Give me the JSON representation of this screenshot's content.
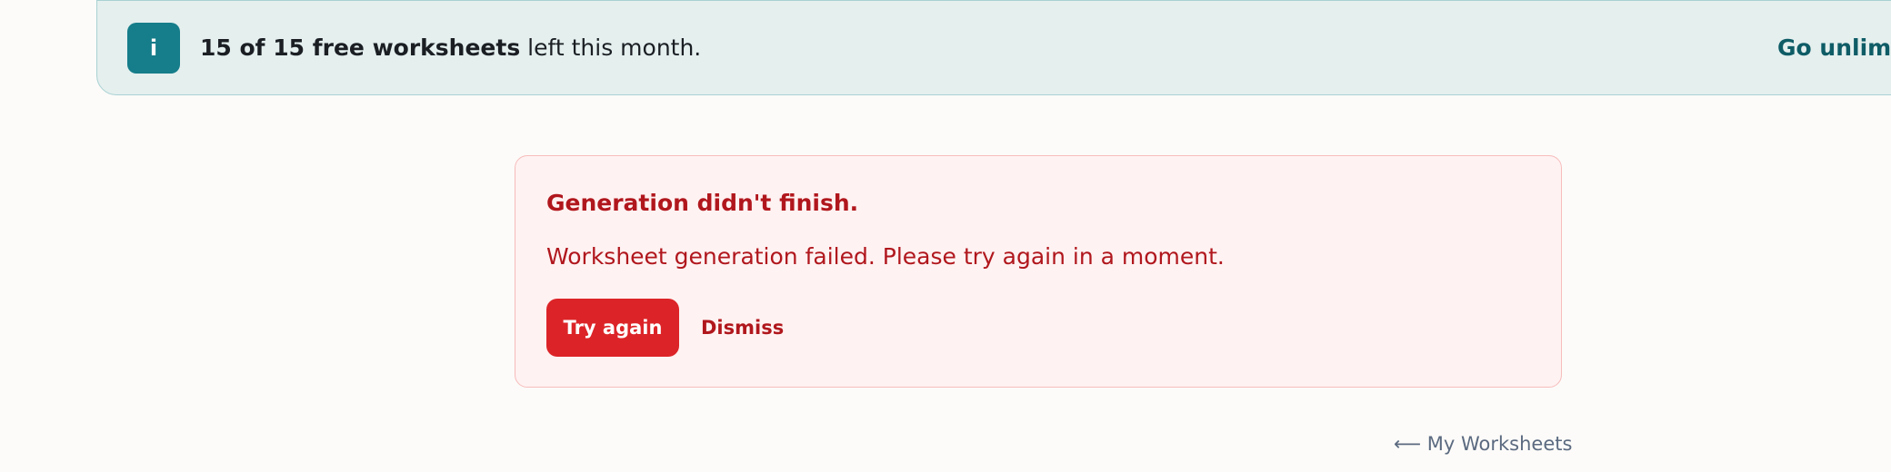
{
  "banner": {
    "icon": "info-icon",
    "icon_glyph": "i",
    "count_text": "15 of 15 free worksheets",
    "suffix_text": " left this month.",
    "cta_label": "Go unlimited"
  },
  "error": {
    "title": "Generation didn't finish.",
    "message": "Worksheet generation failed. Please try again in a moment.",
    "retry_label": "Try again",
    "dismiss_label": "Dismiss"
  },
  "nav": {
    "back_label": "⟵ My Worksheets"
  },
  "colors": {
    "banner_bg": "#e4efee",
    "banner_accent": "#167d8a",
    "error_bg": "#fff2f2",
    "error_text": "#b0171d",
    "error_button": "#dc2428",
    "link_muted": "#5b6a80"
  }
}
